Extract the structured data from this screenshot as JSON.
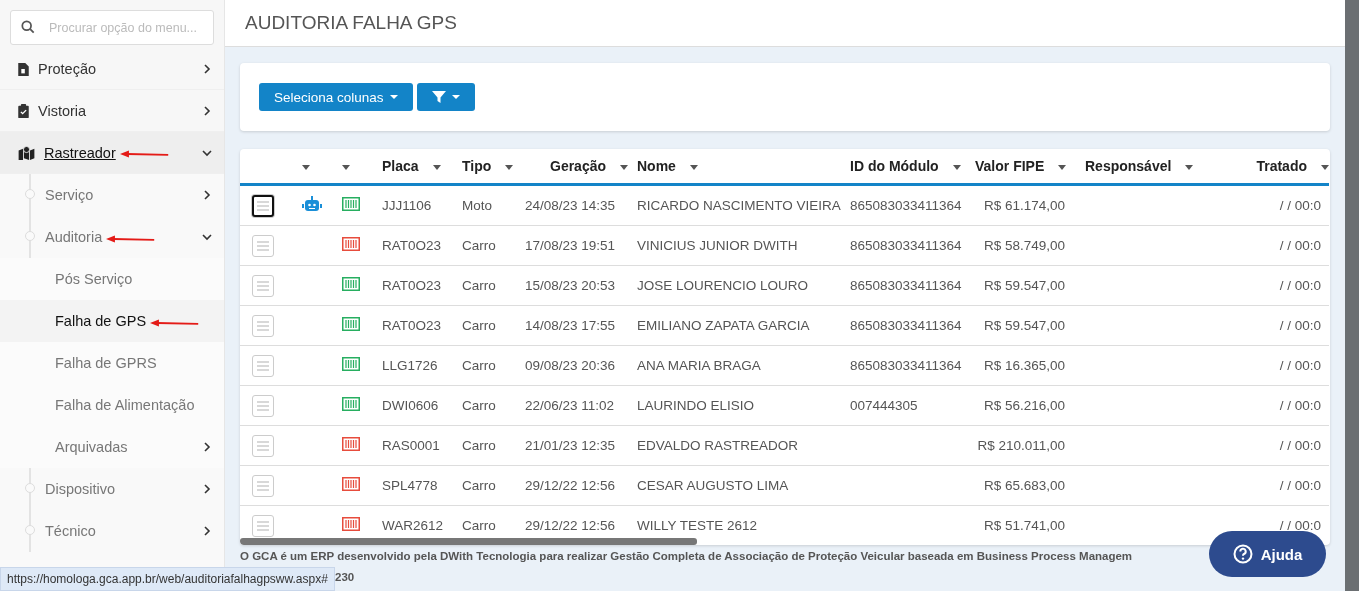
{
  "sidebar": {
    "search": {
      "placeholder": "Procurar opção do menu..."
    },
    "items": [
      {
        "label": "Proteção",
        "kind": "document",
        "expanded": false,
        "hovered": false,
        "arrow": false
      },
      {
        "label": "Vistoria",
        "kind": "clipboard",
        "expanded": false,
        "hovered": false,
        "arrow": false
      },
      {
        "label": "Rastreador",
        "kind": "map",
        "expanded": true,
        "hovered": true,
        "arrow": true,
        "children": [
          {
            "label": "Serviço",
            "expanded": false,
            "arrow": false
          },
          {
            "label": "Auditoria",
            "expanded": true,
            "arrow": true,
            "children": [
              {
                "label": "Pós Serviço",
                "selected": false,
                "arrow": false
              },
              {
                "label": "Falha de GPS",
                "selected": true,
                "arrow": true
              },
              {
                "label": "Falha de GPRS",
                "selected": false,
                "arrow": false
              },
              {
                "label": "Falha de Alimentação",
                "selected": false,
                "arrow": false
              },
              {
                "label": "Arquivadas",
                "selected": false,
                "expanded": false,
                "arrow": false
              }
            ]
          },
          {
            "label": "Dispositivo",
            "expanded": false,
            "arrow": false
          },
          {
            "label": "Técnico",
            "expanded": false,
            "arrow": false
          }
        ]
      }
    ]
  },
  "page": {
    "title": "AUDITORIA FALHA GPS"
  },
  "toolbar": {
    "columns_button": "Seleciona colunas"
  },
  "table": {
    "columns": [
      "Placa",
      "Tipo",
      "Geração",
      "Nome",
      "ID do Módulo",
      "Valor FIPE",
      "Responsável",
      "Tratado"
    ],
    "rows": [
      {
        "focused": true,
        "robot": true,
        "color": "#27ae60",
        "placa": "JJJ1106",
        "tipo": "Moto",
        "geracao": "24/08/23 14:35",
        "nome": "RICARDO NASCIMENTO VIEIRA",
        "modulo": "865083033411364",
        "fipe": "R$ 61.174,00",
        "tratado": "/ / 00:0"
      },
      {
        "focused": false,
        "robot": false,
        "color": "#e74c3c",
        "placa": "RAT0O23",
        "tipo": "Carro",
        "geracao": "17/08/23 19:51",
        "nome": "VINICIUS JUNIOR DWITH",
        "modulo": "865083033411364",
        "fipe": "R$ 58.749,00",
        "tratado": "/ / 00:0"
      },
      {
        "focused": false,
        "robot": false,
        "color": "#27ae60",
        "placa": "RAT0O23",
        "tipo": "Carro",
        "geracao": "15/08/23 20:53",
        "nome": "JOSE LOURENCIO LOURO",
        "modulo": "865083033411364",
        "fipe": "R$ 59.547,00",
        "tratado": "/ / 00:0"
      },
      {
        "focused": false,
        "robot": false,
        "color": "#27ae60",
        "placa": "RAT0O23",
        "tipo": "Carro",
        "geracao": "14/08/23 17:55",
        "nome": "EMILIANO ZAPATA GARCIA",
        "modulo": "865083033411364",
        "fipe": "R$ 59.547,00",
        "tratado": "/ / 00:0"
      },
      {
        "focused": false,
        "robot": false,
        "color": "#27ae60",
        "placa": "LLG1726",
        "tipo": "Carro",
        "geracao": "09/08/23 20:36",
        "nome": "ANA MARIA BRAGA",
        "modulo": "865083033411364",
        "fipe": "R$ 16.365,00",
        "tratado": "/ / 00:0"
      },
      {
        "focused": false,
        "robot": false,
        "color": "#27ae60",
        "placa": "DWI0606",
        "tipo": "Carro",
        "geracao": "22/06/23 11:02",
        "nome": "LAURINDO ELISIO",
        "modulo": "007444305",
        "fipe": "R$ 56.216,00",
        "tratado": "/ / 00:0"
      },
      {
        "focused": false,
        "robot": false,
        "color": "#e74c3c",
        "placa": "RAS0001",
        "tipo": "Carro",
        "geracao": "21/01/23 12:35",
        "nome": "EDVALDO RASTREADOR",
        "modulo": "",
        "fipe": "R$ 210.011,00",
        "tratado": "/ / 00:0"
      },
      {
        "focused": false,
        "robot": false,
        "color": "#e74c3c",
        "placa": "SPL4778",
        "tipo": "Carro",
        "geracao": "29/12/22 12:56",
        "nome": "CESAR AUGUSTO LIMA",
        "modulo": "",
        "fipe": "R$ 65.683,00",
        "tratado": "/ / 00:0"
      },
      {
        "focused": false,
        "robot": false,
        "color": "#e74c3c",
        "placa": "WAR2612",
        "tipo": "Carro",
        "geracao": "29/12/22 12:56",
        "nome": "WILLY TESTE 2612",
        "modulo": "",
        "fipe": "R$ 51.741,00",
        "tratado": "/ / 00:0"
      }
    ]
  },
  "footer": {
    "line_1": "O GCA é um ERP desenvolvido pela DWith Tecnologia para realizar Gestão Completa de Associação de Proteção Veicular baseada em Business Process Managem",
    "line_2": "230"
  },
  "help_button": "Ajuda",
  "status_url": "https://homologa.gca.app.br/web/auditoriafalhagpsww.aspx#"
}
